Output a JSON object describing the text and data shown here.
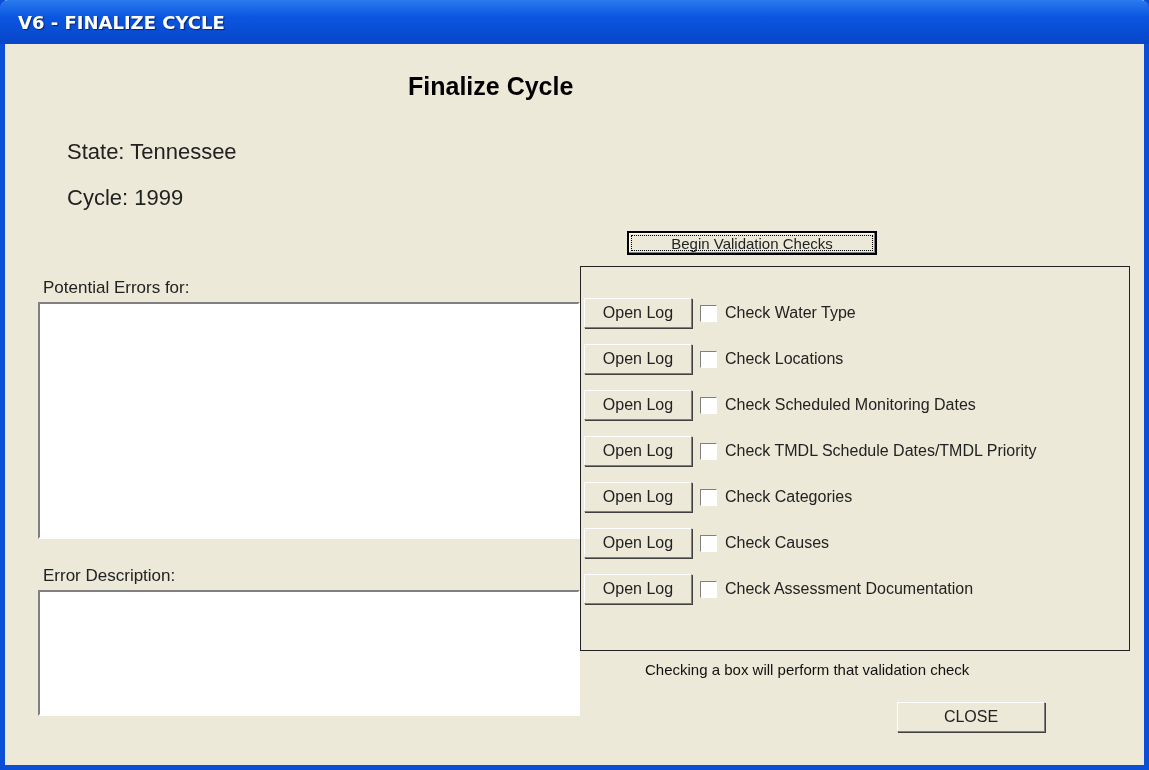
{
  "window": {
    "title": "V6 - FINALIZE CYCLE"
  },
  "heading": "Finalize Cycle",
  "info": [
    "State: Tennessee",
    "Cycle: 1999"
  ],
  "begin_button": "Begin Validation Checks",
  "potential_errors": {
    "label": "Potential Errors for:"
  },
  "error_description": {
    "label": "Error Description:"
  },
  "checks": [
    {
      "button": "Open Log",
      "label": "Check Water Type",
      "checked": false
    },
    {
      "button": "Open Log",
      "label": "Check Locations",
      "checked": false
    },
    {
      "button": "Open Log",
      "label": "Check Scheduled Monitoring Dates",
      "checked": false
    },
    {
      "button": "Open Log",
      "label": "Check TMDL Schedule Dates/TMDL Priority",
      "checked": false
    },
    {
      "button": "Open Log",
      "label": "Check Categories",
      "checked": false
    },
    {
      "button": "Open Log",
      "label": "Check Causes",
      "checked": false
    },
    {
      "button": "Open Log",
      "label": "Check Assessment Documentation",
      "checked": false
    }
  ],
  "hint": "Checking a box will perform that validation check",
  "close_button": "CLOSE"
}
